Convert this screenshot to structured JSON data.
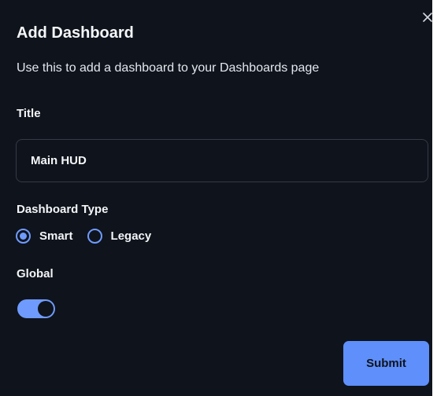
{
  "modal": {
    "title": "Add Dashboard",
    "subtitle": "Use this to add a dashboard to your Dashboards page",
    "close_icon": "close-icon"
  },
  "form": {
    "title_label": "Title",
    "title_value": "Main HUD",
    "type_label": "Dashboard Type",
    "type_options": [
      {
        "label": "Smart",
        "selected": true
      },
      {
        "label": "Legacy",
        "selected": false
      }
    ],
    "global_label": "Global",
    "global_enabled": true,
    "submit_label": "Submit"
  },
  "colors": {
    "background": "#0f131b",
    "accent": "#5e8ffb",
    "input_border": "#343a47",
    "text": "#f2f4f8"
  }
}
